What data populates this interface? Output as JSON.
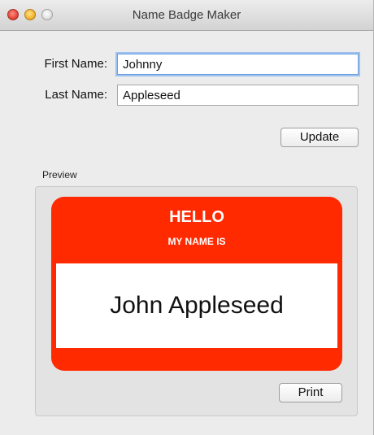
{
  "window": {
    "title": "Name Badge Maker"
  },
  "form": {
    "first_name_label": "First Name:",
    "first_name_value": "Johnny",
    "last_name_label": "Last Name:",
    "last_name_value": "Appleseed",
    "update_label": "Update"
  },
  "preview": {
    "group_label": "Preview",
    "badge": {
      "hello": "HELLO",
      "subtitle": "MY NAME IS",
      "name": "John Appleseed",
      "color": "#ff2a00"
    },
    "print_label": "Print"
  }
}
